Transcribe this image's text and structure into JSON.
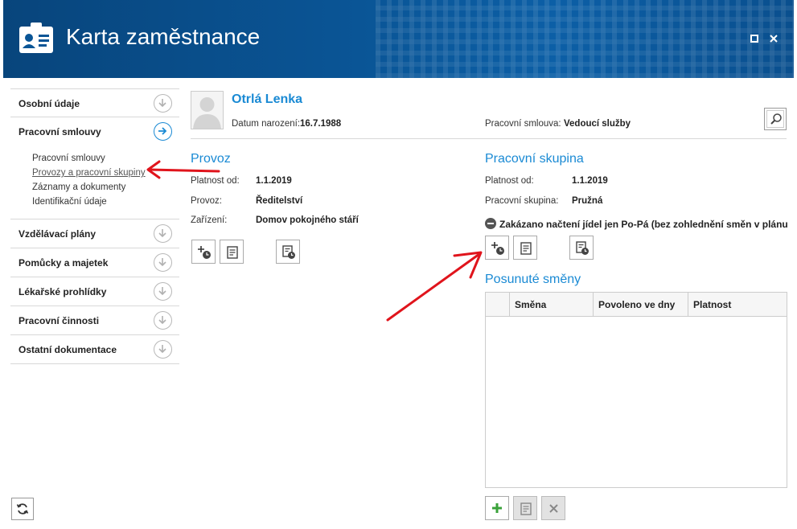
{
  "window": {
    "title": "Karta zaměstnance"
  },
  "sidebar": {
    "items_top": [
      {
        "label": "Osobní údaje"
      },
      {
        "label": "Pracovní smlouvy"
      }
    ],
    "subitems": [
      {
        "label": "Pracovní smlouvy"
      },
      {
        "label": "Provozy a pracovní skupiny"
      },
      {
        "label": "Záznamy a dokumenty"
      },
      {
        "label": "Identifikační údaje"
      }
    ],
    "items_bottom": [
      {
        "label": "Vzdělávací plány"
      },
      {
        "label": "Pomůcky a majetek"
      },
      {
        "label": "Lékařské prohlídky"
      },
      {
        "label": "Pracovní činnosti"
      },
      {
        "label": "Ostatní dokumentace"
      }
    ]
  },
  "person": {
    "name": "Otrlá Lenka",
    "birth_label": "Datum narození:",
    "birth_value": "16.7.1988",
    "contract_label": "Pracovní smlouva:",
    "contract_value": "Vedoucí služby"
  },
  "provoz": {
    "title": "Provoz",
    "valid_label": "Platnost od:",
    "valid_value": "1.1.2019",
    "provoz_label": "Provoz:",
    "provoz_value": "Ředitelství",
    "device_label": "Zařízení:",
    "device_value": "Domov pokojného stáří"
  },
  "group": {
    "title": "Pracovní skupina",
    "valid_label": "Platnost od:",
    "valid_value": "1.1.2019",
    "group_label": "Pracovní skupina:",
    "group_value": "Pružná",
    "notice": "Zakázano načtení jídel jen Po-Pá (bez zohlednění směn v plánu"
  },
  "shifts": {
    "title": "Posunuté směny",
    "columns": [
      "Směna",
      "Povoleno ve dny",
      "Platnost"
    ]
  },
  "colors": {
    "header": "#0a5596",
    "accent": "#1a8ad4",
    "annotation": "#e0141c"
  }
}
